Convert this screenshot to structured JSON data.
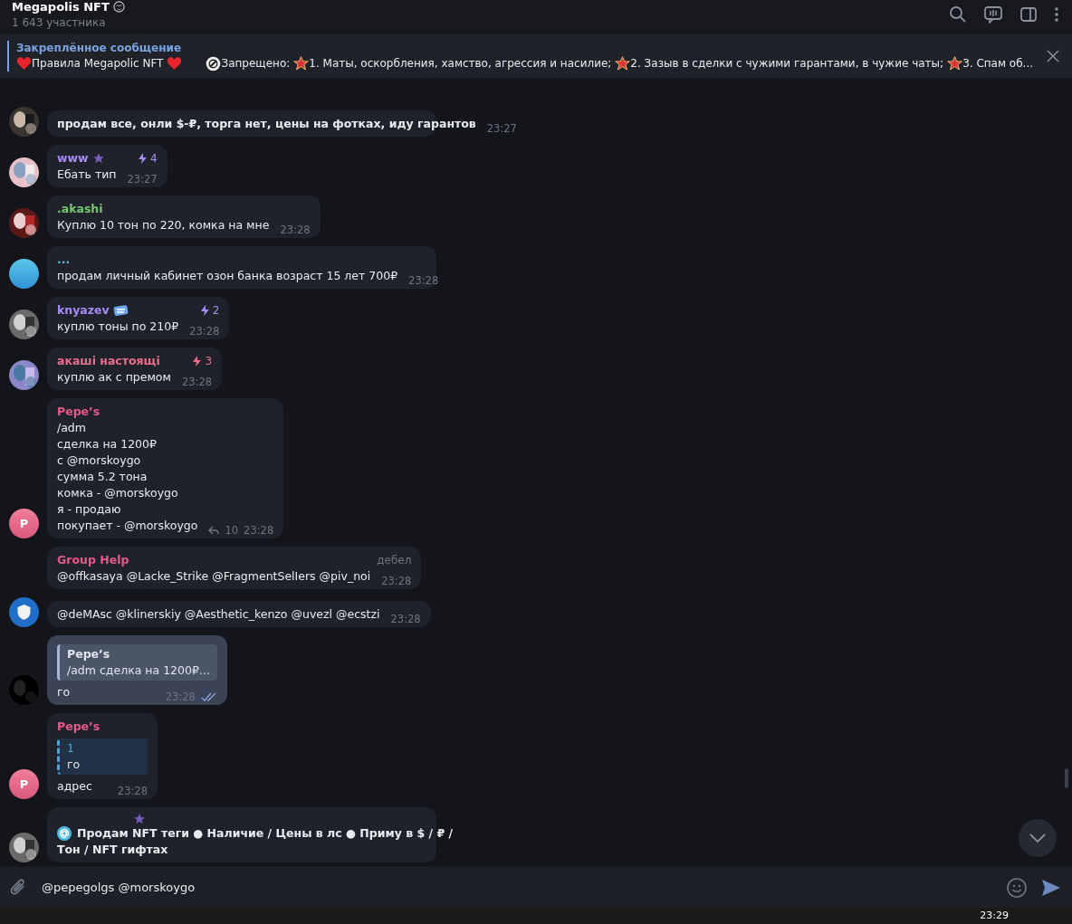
{
  "header": {
    "title": "Megapolis NFT",
    "subtitle": "1 643 участника"
  },
  "pinned": {
    "label": "Закреплённое сообщение",
    "parts": [
      {
        "kind": "heart"
      },
      {
        "kind": "text",
        "text": "Правила Megapolic NFT"
      },
      {
        "kind": "heart"
      },
      {
        "kind": "space"
      },
      {
        "kind": "nosign"
      },
      {
        "kind": "text",
        "text": "Запрещено:"
      },
      {
        "kind": "star"
      },
      {
        "kind": "text",
        "text": "1. Маты, оскорбления, хамство, агрессия и насилие;"
      },
      {
        "kind": "star"
      },
      {
        "kind": "text",
        "text": "2. Зазыв в сделки с чужими гарантами, в чужие чаты;"
      },
      {
        "kind": "star"
      },
      {
        "kind": "text",
        "text": "3. Спам об..."
      }
    ]
  },
  "messages": [
    {
      "avatar": {
        "kind": "picture"
      },
      "bold": true,
      "lines": [
        "продам все, онли $-₽, торга нет, цены на фотках, иду гарантов"
      ],
      "time": "23:27"
    },
    {
      "avatar": {
        "kind": "picture"
      },
      "author": "www",
      "color": "#a58cf7",
      "badge": {
        "kind": "star"
      },
      "boost": "4",
      "lines": [
        "Ебать тип"
      ],
      "time": "23:27"
    },
    {
      "avatar": {
        "kind": "picture"
      },
      "author": ".akashi",
      "color": "#72c96b",
      "lines": [
        "Куплю 10 тон по 220, комка на мне"
      ],
      "time": "23:28"
    },
    {
      "avatar": {
        "kind": "plain"
      },
      "author": "...",
      "color": "#5bbfe6",
      "lines": [
        "продам личный кабинет озон банка возраст 15 лет 700₽"
      ],
      "time": "23:28"
    },
    {
      "avatar": {
        "kind": "picture"
      },
      "author": "knyazev",
      "color": "#a58cf7",
      "badge": {
        "kind": "sticker"
      },
      "boost": "2",
      "lines": [
        "куплю тоны по 210₽"
      ],
      "time": "23:28"
    },
    {
      "avatar": {
        "kind": "picture"
      },
      "author": "акаші настоящі",
      "color": "#e8708a",
      "boost": "3",
      "lines": [
        "куплю ак с премом"
      ],
      "time": "23:28"
    },
    {
      "avatar": {
        "kind": "letter",
        "letter": "P"
      },
      "author": "Pepe’s",
      "color": "#e8588a",
      "lines": [
        "/adm",
        "сделка на 1200₽",
        "с @morskoygo",
        "сумма 5.2 тона",
        "комка - @morskoygo",
        "я - продаю",
        "покупает - @morskoygo"
      ],
      "replies": "10",
      "time": "23:28"
    },
    {
      "author": "Group Help",
      "color": "#e8588a",
      "tag": "дебел",
      "lines": [
        "@offkasaya @Lacke_Strike @FragmentSelIers @piv_noi"
      ],
      "time": "23:28"
    },
    {
      "avatar": {
        "kind": "shield"
      },
      "lines": [
        "@deMAsc @klinerskiy @Aesthetic_kenzo @uvezl @ecstzi"
      ],
      "time": "23:28"
    },
    {
      "avatar": {
        "kind": "dark"
      },
      "outgoing": true,
      "quote": {
        "author": "Pepe’s",
        "text": "/adm  сделка на 1200₽..."
      },
      "lines": [
        "го"
      ],
      "time": "23:28",
      "read": true
    },
    {
      "avatar": {
        "kind": "letter",
        "letter": "P"
      },
      "author": "Pepe’s",
      "color": "#e8588a",
      "quote": {
        "text": "1",
        "text2": "го"
      },
      "lines": [
        "адрес"
      ],
      "time": "23:28"
    },
    {
      "avatar": {
        "kind": "picture"
      },
      "badge": {
        "kind": "star"
      },
      "lead_icon": {
        "kind": "at"
      },
      "bold": true,
      "lines": [
        "Продам NFT теги ● Наличие / Цены в лс ● Приму в $ / ₽ /",
        "Тон / NFT гифтах"
      ]
    }
  ],
  "composer": {
    "value": "@pepegolgs @morskoygo"
  },
  "taskbar": {
    "time": "23:29"
  }
}
